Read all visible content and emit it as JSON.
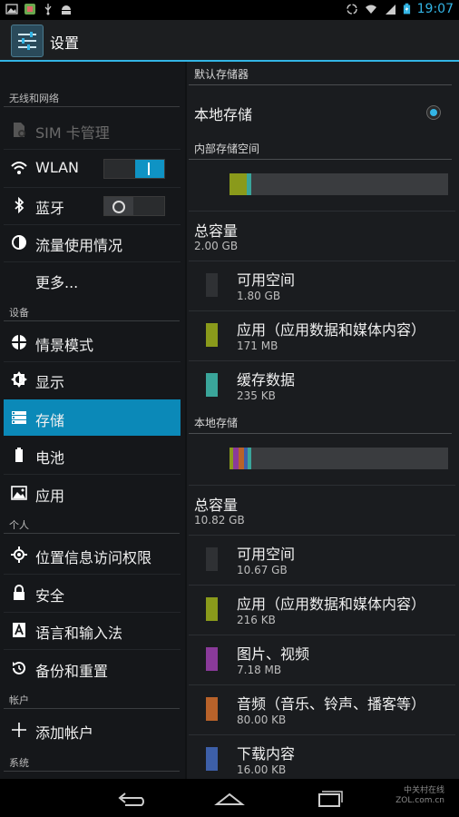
{
  "status_bar": {
    "time": "19:07"
  },
  "action_bar": {
    "title": "设置"
  },
  "left_pane": {
    "categories": {
      "wireless": "无线和网络",
      "device": "设备",
      "personal": "个人",
      "accounts": "帐户",
      "system": "系统"
    },
    "items": {
      "sim": "SIM 卡管理",
      "wlan": "WLAN",
      "bluetooth": "蓝牙",
      "data_usage": "流量使用情况",
      "more": "更多...",
      "profiles": "情景模式",
      "display": "显示",
      "storage": "存储",
      "battery": "电池",
      "apps": "应用",
      "location": "位置信息访问权限",
      "security": "安全",
      "language": "语言和输入法",
      "backup": "备份和重置",
      "add_account": "添加帐户"
    },
    "wlan_toggle": "on",
    "bluetooth_toggle": "off",
    "selected": "存储"
  },
  "right_pane": {
    "default_storage": {
      "header": "默认存储器",
      "option": "本地存储",
      "selected": true
    },
    "internal": {
      "header": "内部存储空间",
      "total_label": "总容量",
      "total_value": "2.00 GB",
      "entries": [
        {
          "label": "可用空间",
          "value": "1.80 GB",
          "color": "#2f3134"
        },
        {
          "label": "应用（应用数据和媒体内容）",
          "value": "171 MB",
          "color": "#8a9a1b"
        },
        {
          "label": "缓存数据",
          "value": "235 KB",
          "color": "#3aa59a"
        }
      ]
    },
    "local": {
      "header": "本地存储",
      "total_label": "总容量",
      "total_value": "10.82 GB",
      "entries": [
        {
          "label": "可用空间",
          "value": "10.67 GB",
          "color": "#2f3134"
        },
        {
          "label": "应用（应用数据和媒体内容）",
          "value": "216 KB",
          "color": "#8a9a1b"
        },
        {
          "label": "图片、视频",
          "value": "7.18 MB",
          "color": "#8a3a9a"
        },
        {
          "label": "音频（音乐、铃声、播客等）",
          "value": "80.00 KB",
          "color": "#b8622a"
        },
        {
          "label": "下载内容",
          "value": "16.00 KB",
          "color": "#3d5fa8"
        }
      ]
    }
  },
  "watermark": {
    "line1": "中关村在线",
    "line2": "ZOL.com.cn"
  },
  "accent_color": "#33b5e5",
  "selected_color": "#0b89b8"
}
